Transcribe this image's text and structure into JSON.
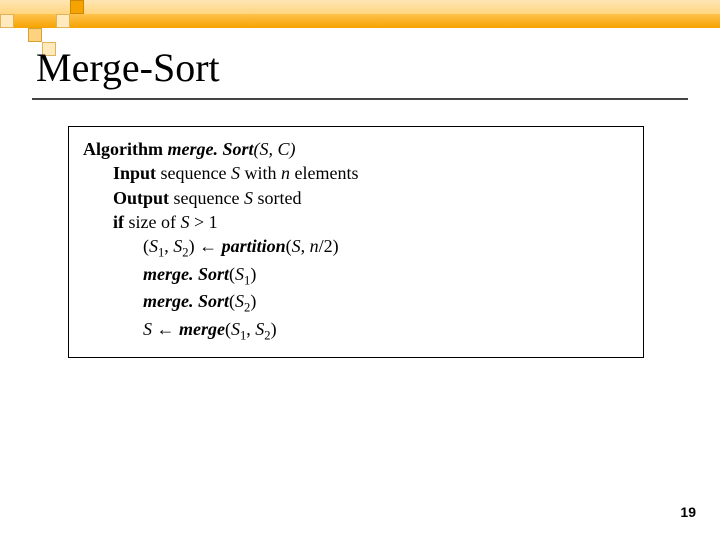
{
  "title": "Merge-Sort",
  "pagenum": "19",
  "algo": {
    "line1": {
      "kw": "Algorithm",
      "fn": "merge. Sort",
      "args": "(S, C)"
    },
    "line2": {
      "kw": "Input",
      "text_a": " sequence ",
      "S": "S",
      "text_b": " with ",
      "n": "n",
      "text_c": " elements"
    },
    "line3": {
      "kw": "Output",
      "text_a": " sequence ",
      "S": "S",
      "text_b": " sorted"
    },
    "line4": {
      "kw": "if",
      "text_a": " size of ",
      "S": "S",
      "text_b": " > 1"
    },
    "line5": {
      "lp": "(",
      "S1": "S",
      "s1": "1",
      "comma": ", ",
      "S2": "S",
      "s2": "2",
      "rp": ") ",
      "arrow": "←",
      "fn": " partition",
      "args_a": "(",
      "argS": "S",
      "args_b": ", ",
      "argn": "n",
      "args_c": "/2)"
    },
    "line6": {
      "fn": "merge. Sort",
      "lp": "(",
      "S": "S",
      "s": "1",
      "rp": ")"
    },
    "line7": {
      "fn": "merge. Sort",
      "lp": "(",
      "S": "S",
      "s": "2",
      "rp": ")"
    },
    "line8": {
      "S": "S",
      "arrow": " ← ",
      "fn": "merge",
      "lp": "(",
      "S1": "S",
      "s1": "1",
      "comma": ", ",
      "S2": "S",
      "s2": "2",
      "rp": ")"
    }
  }
}
